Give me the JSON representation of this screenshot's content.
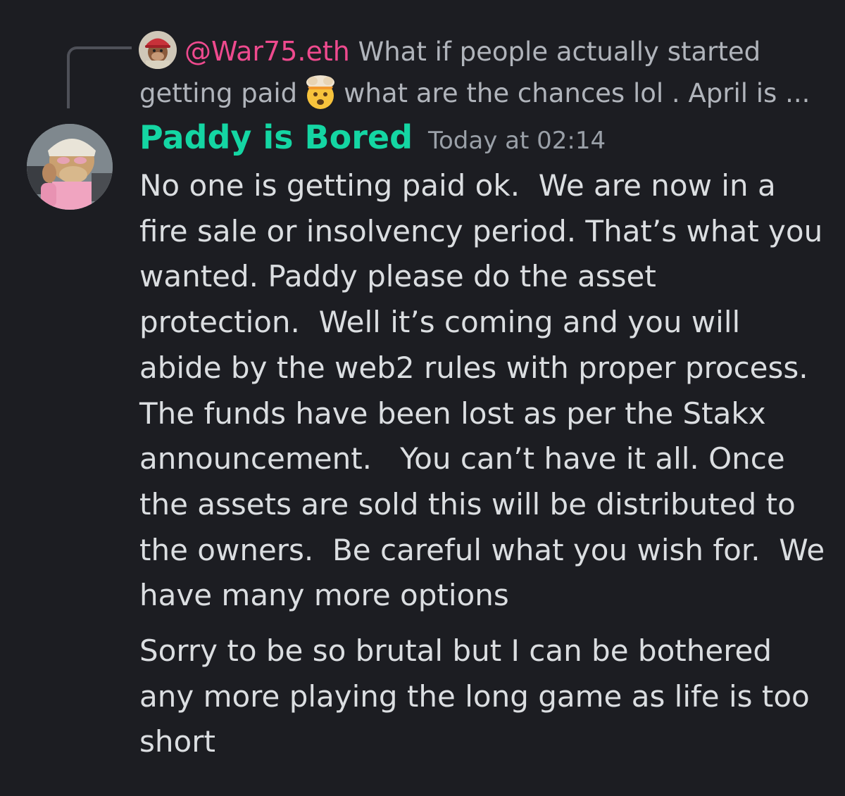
{
  "reply": {
    "author": "@War75.eth",
    "text_before_emoji": "What if people actually started getting paid",
    "text_after_emoji": "what are the chances lol . April is ...",
    "avatar_icon": "ape-avatar-red-cap",
    "emoji_icon": "exploding-head-emoji"
  },
  "message": {
    "author": "Paddy is Bored",
    "timestamp": "Today at 02:14",
    "avatar_icon": "bored-ape-avatar-pink",
    "body_1": "No one is getting paid ok.  We are now in a fire sale or insolvency period. That’s what you wanted. Paddy please do the asset protection.  Well it’s coming and you will abide by the web2 rules with proper process.  The funds have been lost as per the Stakx announcement.   You can’t have it all. Once the assets are sold this will be distributed to the owners.  Be careful what you wish for.  We have many more options",
    "body_2": "Sorry to be so brutal but I can be bothered any more playing the long game as life is too short"
  },
  "colors": {
    "background": "#1c1d22",
    "reply_author": "#ee4a8e",
    "author": "#14d6a3",
    "body_text": "#dbdee1",
    "muted_text": "#b0b4bb"
  }
}
